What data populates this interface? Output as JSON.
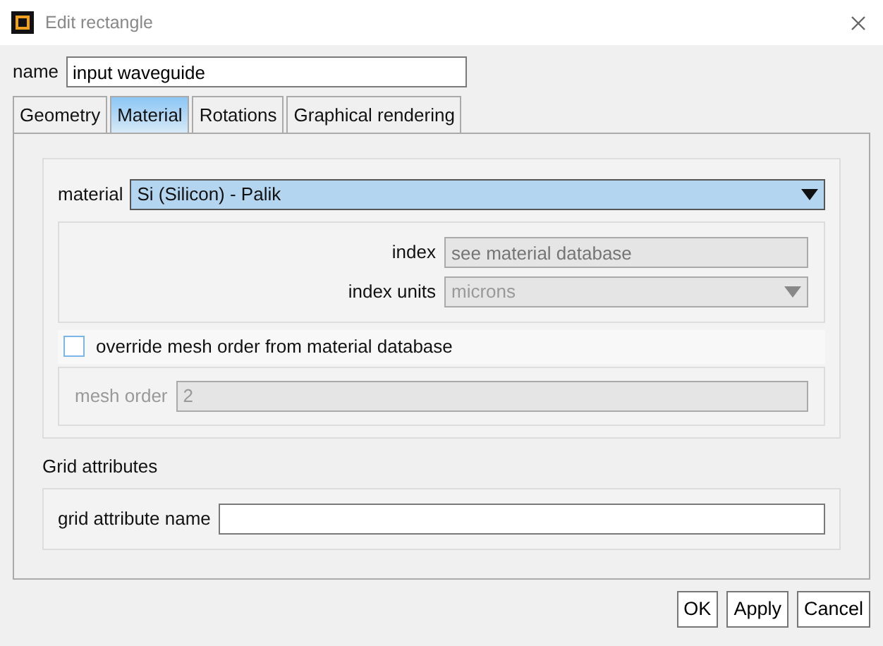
{
  "window": {
    "title": "Edit rectangle"
  },
  "name": {
    "label": "name",
    "value": "input waveguide"
  },
  "tabs": [
    {
      "label": "Geometry",
      "selected": false
    },
    {
      "label": "Material",
      "selected": true
    },
    {
      "label": "Rotations",
      "selected": false
    },
    {
      "label": "Graphical rendering",
      "selected": false
    }
  ],
  "material": {
    "label": "material",
    "value": "Si (Silicon) - Palik"
  },
  "index": {
    "label": "index",
    "placeholder": "see material database",
    "disabled": true
  },
  "index_units": {
    "label": "index units",
    "value": "microns",
    "disabled": true
  },
  "override": {
    "label": "override mesh order from material database",
    "checked": false
  },
  "mesh_order": {
    "label": "mesh order",
    "value": "2",
    "disabled": true
  },
  "grid": {
    "heading": "Grid attributes",
    "label": "grid attribute name"
  },
  "buttons": [
    "OK",
    "Apply",
    "Cancel"
  ]
}
